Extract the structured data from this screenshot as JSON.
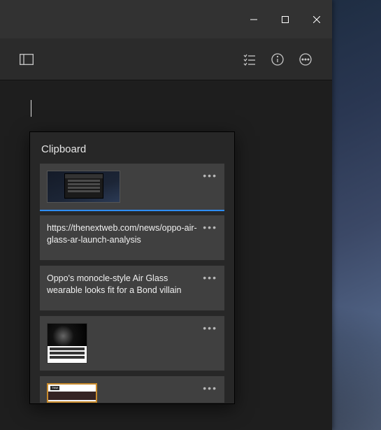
{
  "window": {
    "minimize": "minimize",
    "maximize": "maximize",
    "close": "close"
  },
  "toolbar": {
    "sidebar_toggle": "Toggle sidebar",
    "checklist": "Checklist",
    "info": "Info",
    "more": "More"
  },
  "clipboard": {
    "title": "Clipboard",
    "items": [
      {
        "type": "image",
        "alt": "Screenshot thumbnail of dark app window on desktop",
        "selected": true
      },
      {
        "type": "text",
        "text": "https://thenextweb.com/news/oppo-air-glass-ar-launch-analysis"
      },
      {
        "type": "text",
        "text": "Oppo's monocle-style Air Glass wearable looks fit for a Bond villain"
      },
      {
        "type": "image",
        "alt": "Article thumbnail with product photo and caption text"
      },
      {
        "type": "image",
        "alt": "Browser window thumbnail on TNW page"
      }
    ],
    "more_label": "More options"
  }
}
